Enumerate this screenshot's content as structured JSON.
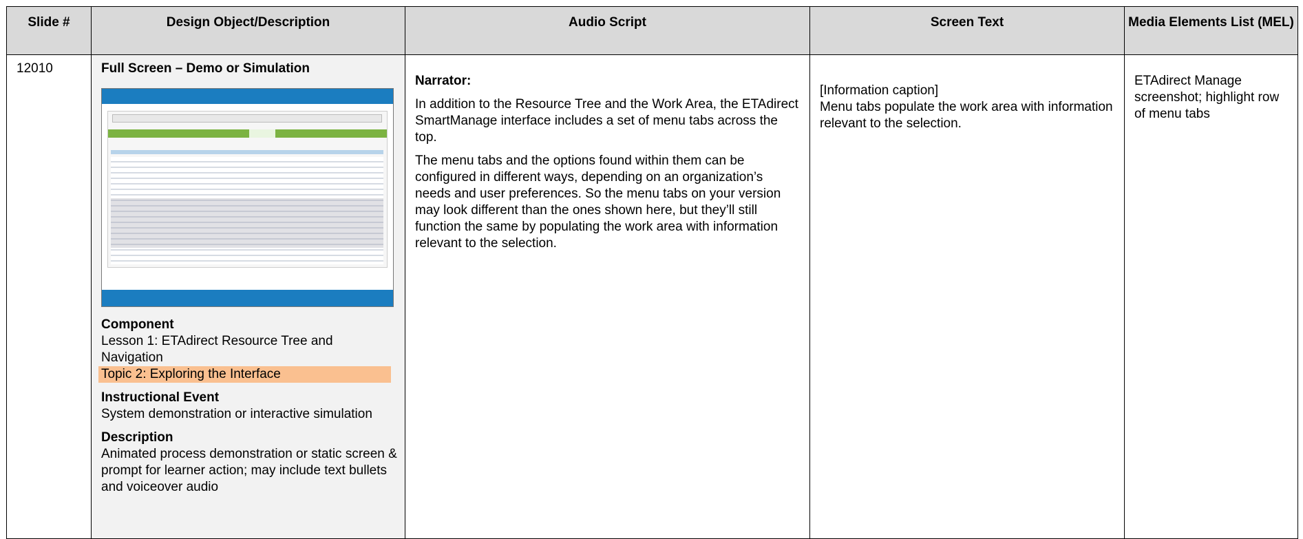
{
  "headers": {
    "slide_num": "Slide #",
    "design": "Design Object/Description",
    "audio": "Audio Script",
    "screen_text": "Screen Text",
    "mel": "Media Elements List (MEL)"
  },
  "row": {
    "slide_num": "12010",
    "design": {
      "title": "Full Screen – Demo or Simulation",
      "component_heading": "Component",
      "lesson": "Lesson 1: ETAdirect Resource Tree and Navigation",
      "topic": "Topic 2: Exploring the Interface",
      "instructional_event_heading": "Instructional Event",
      "instructional_event": "System demonstration or interactive simulation",
      "description_heading": "Description",
      "description": "Animated process demonstration or static screen & prompt for learner action; may include text bullets and voiceover audio"
    },
    "audio": {
      "speaker": "Narrator:",
      "para1": "In addition to the Resource Tree and the Work Area, the ETAdirect SmartManage interface includes a set of menu tabs across the top.",
      "para2": "The menu tabs and the options found within them can be configured in different ways, depending on an organization’s needs and user preferences.  So the menu tabs on your version may look different than the ones shown here, but they’ll still function the same by populating the work area with information relevant to the selection."
    },
    "screen_text": {
      "caption_label": "[Information caption]",
      "caption_text": "Menu tabs populate the work area with information relevant to the selection."
    },
    "mel": "ETAdirect Manage screenshot; highlight row of menu tabs"
  }
}
